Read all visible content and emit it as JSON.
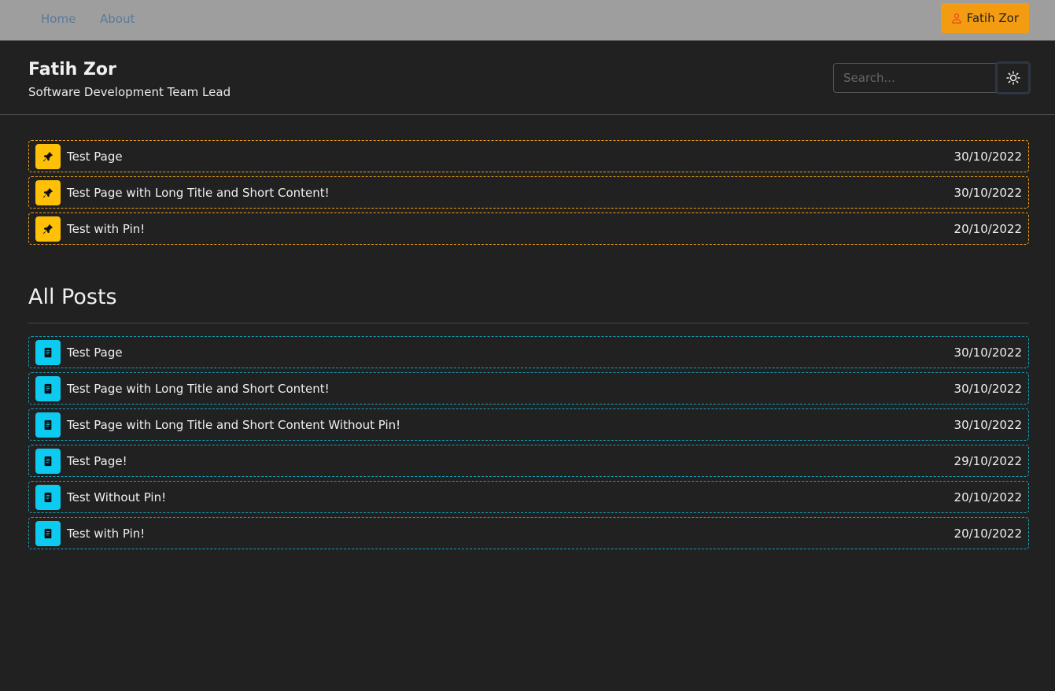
{
  "nav": {
    "items": [
      {
        "label": "Home"
      },
      {
        "label": "About"
      }
    ],
    "user_button": "Fatih Zor"
  },
  "header": {
    "title": "Fatih Zor",
    "subtitle": "Software Development Team Lead",
    "search_placeholder": "Search..."
  },
  "pinned": [
    {
      "title": "Test Page",
      "date": "30/10/2022"
    },
    {
      "title": "Test Page with Long Title and Short Content!",
      "date": "30/10/2022"
    },
    {
      "title": "Test with Pin!",
      "date": "20/10/2022"
    }
  ],
  "all_posts": {
    "heading": "All Posts",
    "items": [
      {
        "title": "Test Page",
        "date": "30/10/2022"
      },
      {
        "title": "Test Page with Long Title and Short Content!",
        "date": "30/10/2022"
      },
      {
        "title": "Test Page with Long Title and Short Content Without Pin!",
        "date": "30/10/2022"
      },
      {
        "title": "Test Page!",
        "date": "29/10/2022"
      },
      {
        "title": "Test Without Pin!",
        "date": "20/10/2022"
      },
      {
        "title": "Test with Pin!",
        "date": "20/10/2022"
      }
    ]
  },
  "icons": {
    "pinned": "pin-icon",
    "post": "document-icon",
    "theme": "sun-icon",
    "user": "user-icon"
  }
}
